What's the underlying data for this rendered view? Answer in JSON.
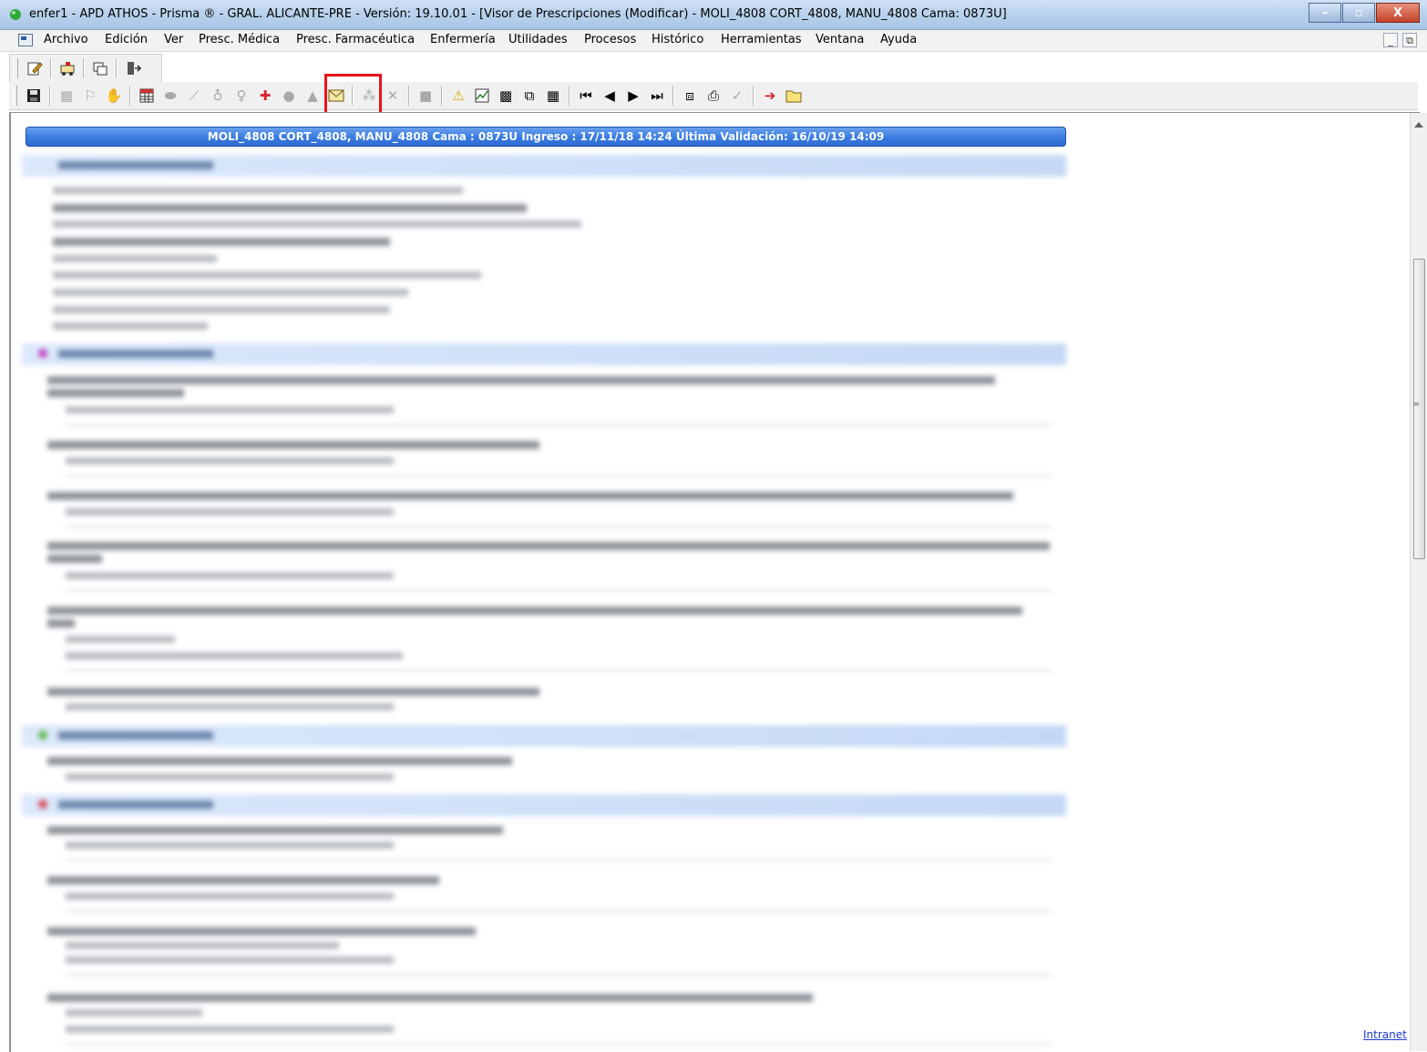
{
  "window": {
    "title": "enfer1 - APD ATHOS - Prisma ® - GRAL. ALICANTE-PRE - Versión: 19.10.01 - [Visor de Prescripciones (Modificar) - MOLI_4808 CORT_4808, MANU_4808 Cama: 0873U]",
    "minimize": "–",
    "restore": "▫",
    "close": "X"
  },
  "menubar": {
    "items": [
      "Archivo",
      "Edición",
      "Ver",
      "Presc. Médica",
      "Presc. Farmacéutica",
      "Enfermería",
      "Utilidades",
      "Procesos",
      "Histórico",
      "Herramientas",
      "Ventana",
      "Ayuda"
    ],
    "mdi_minimize": "_",
    "mdi_restore": "⧉"
  },
  "toolbar1": {
    "icons": [
      "edit-icon",
      "ambulance-icon",
      "copy-window-icon",
      "exit-door-icon"
    ]
  },
  "toolbar2": {
    "highlighted_icon": "envelope-icon",
    "highlight_color": "#e8131b"
  },
  "patient_header": {
    "text": "MOLI_4808 CORT_4808, MANU_4808  Cama : 0873U  Ingreso : 17/11/18 14:24  Última Validación: 16/10/19 14:09"
  },
  "footer": {
    "intranet_link": "Intranet"
  },
  "colors": {
    "header_bar": "#3a7be0",
    "section_bar": "#dbe8fb",
    "highlight": "#e8131b",
    "link": "#1a3bd1"
  }
}
